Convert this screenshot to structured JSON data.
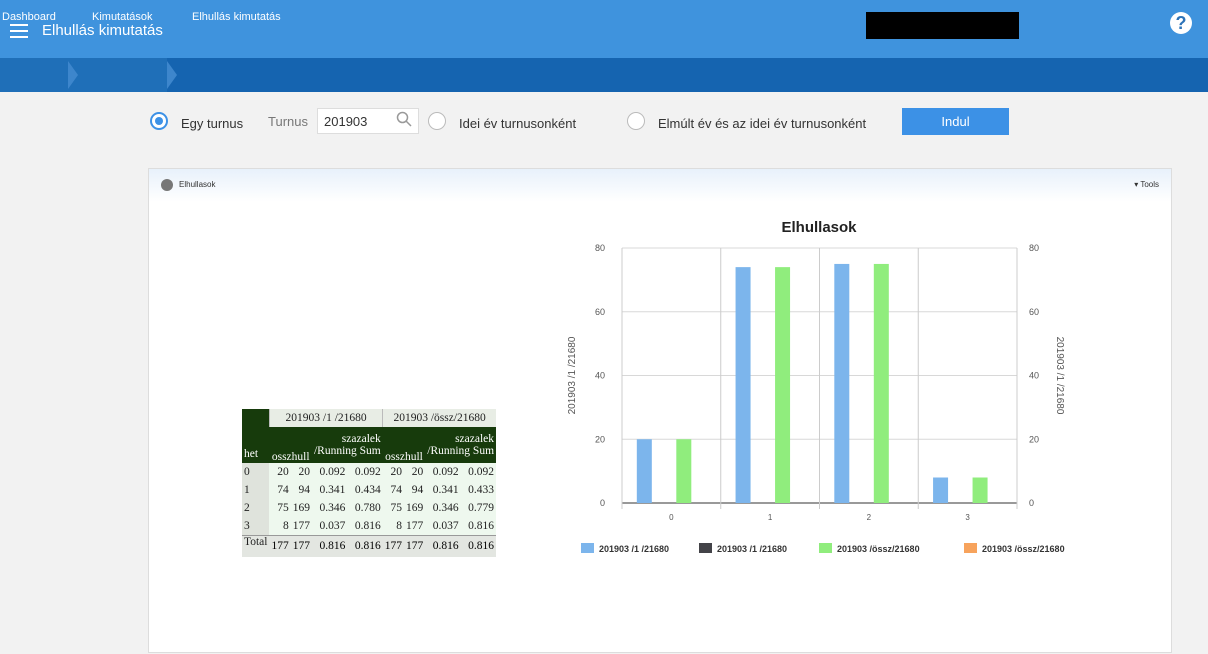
{
  "header": {
    "title": "Elhullás kimutatás"
  },
  "breadcrumb": [
    "Dashboard",
    "Kimutatások",
    "Elhullás kimutatás"
  ],
  "filters": {
    "option1": "Egy turnus",
    "turnus_label": "Turnus",
    "turnus_value": "201903",
    "option2": "Idei év turnusonként",
    "option3": "Elmúlt év és az idei év turnusonként",
    "button": "Indul"
  },
  "panel": {
    "title": "Elhullasok",
    "tools": "▾ Tools"
  },
  "table": {
    "group1": "201903 /1 /21680",
    "group2": "201903 /össz/21680",
    "row_header": "het",
    "col_osszhull": "osszhull",
    "col_szazalek": "szazalek",
    "col_running": "/Running Sum",
    "rows": [
      {
        "het": "0",
        "c": [
          "20",
          "20",
          "0.092",
          "0.092",
          "20",
          "20",
          "0.092",
          "0.092"
        ]
      },
      {
        "het": "1",
        "c": [
          "74",
          "94",
          "0.341",
          "0.434",
          "74",
          "94",
          "0.341",
          "0.433"
        ]
      },
      {
        "het": "2",
        "c": [
          "75",
          "169",
          "0.346",
          "0.780",
          "75",
          "169",
          "0.346",
          "0.779"
        ]
      },
      {
        "het": "3",
        "c": [
          "8",
          "177",
          "0.037",
          "0.816",
          "8",
          "177",
          "0.037",
          "0.816"
        ]
      }
    ],
    "total_label": "Total",
    "total": [
      "177",
      "177",
      "0.816",
      "0.816",
      "177",
      "177",
      "0.816",
      "0.816"
    ]
  },
  "chart_data": {
    "type": "bar",
    "title": "Elhullasok",
    "categories": [
      "0",
      "1",
      "2",
      "3"
    ],
    "ylabel": "201903 /1 /21680",
    "ylabel_right": "201903 /1 /21680",
    "ylim": [
      0,
      80
    ],
    "yticks": [
      "0",
      "20",
      "40",
      "60",
      "80"
    ],
    "series": [
      {
        "name": "201903 /1 /21680",
        "values": [
          20,
          74,
          75,
          8
        ],
        "color": "#7cb5ec"
      },
      {
        "name": "201903 /1 /21680",
        "values": [],
        "color": "#434348"
      },
      {
        "name": "201903 /össz/21680",
        "values": [
          20,
          74,
          75,
          8
        ],
        "color": "#90ed7d"
      },
      {
        "name": "201903 /össz/21680",
        "values": [],
        "color": "#f7a35c"
      }
    ]
  }
}
